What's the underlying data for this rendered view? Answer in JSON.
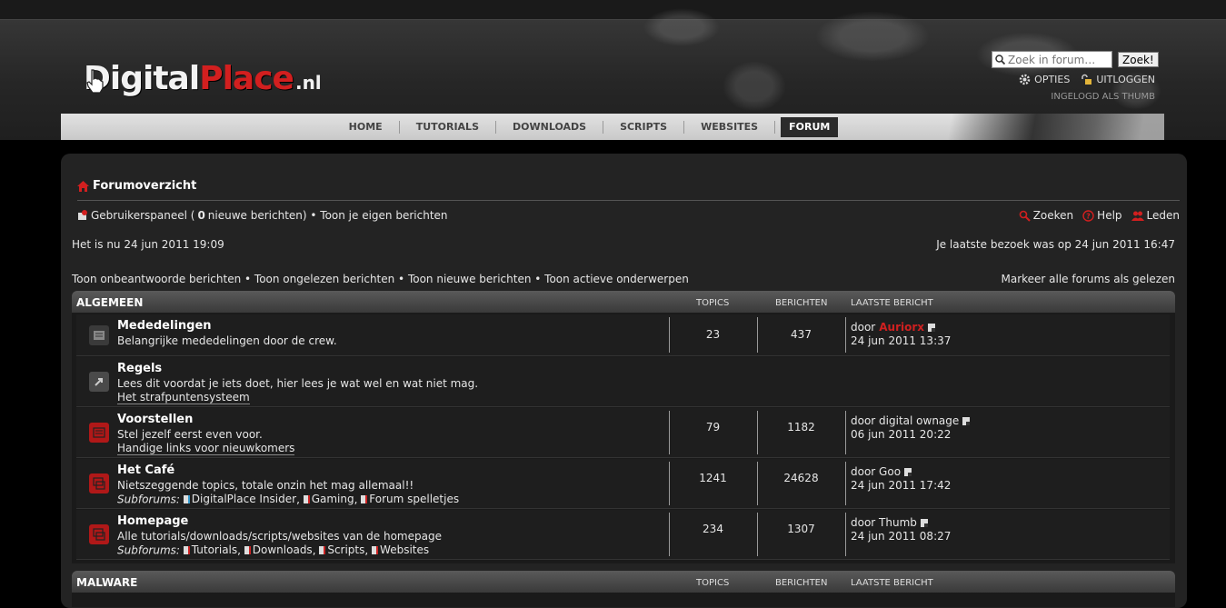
{
  "header": {
    "logo": {
      "part1": "Digital",
      "part2": "Place",
      "part3": ".nl"
    },
    "search": {
      "placeholder": "Zoek in forum…",
      "button": "Zoek!"
    },
    "user_menu": {
      "options": "OPTIES",
      "logout": "UITLOGGEN",
      "logged_in": "INGELOGD ALS THUMB"
    },
    "nav": [
      "HOME",
      "TUTORIALS",
      "DOWNLOADS",
      "SCRIPTS",
      "WEBSITES",
      "FORUM"
    ],
    "nav_active": "FORUM"
  },
  "breadcrumb": "Forumoverzicht",
  "panel": {
    "ucp_prefix": "Gebruikerspaneel (",
    "new_count": "0",
    "ucp_suffix": " nieuwe berichten) • Toon je eigen berichten",
    "search": "Zoeken",
    "help": "Help",
    "members": "Leden"
  },
  "time": {
    "now": "Het is nu 24 jun 2011 19:09",
    "last_visit": "Je laatste bezoek was op 24 jun 2011 16:47"
  },
  "links": {
    "left": "Toon onbeantwoorde berichten • Toon ongelezen berichten • Toon nieuwe berichten • Toon actieve onderwerpen",
    "right": "Markeer alle forums als gelezen"
  },
  "columns": {
    "topics": "TOPICS",
    "posts": "BERICHTEN",
    "last": "LAATSTE BERICHT"
  },
  "categories": [
    {
      "name": "ALGEMEEN",
      "forums": [
        {
          "name": "Mededelingen",
          "desc": "Belangrijke mededelingen door de crew.",
          "topics": "23",
          "posts": "437",
          "last_by_prefix": "door ",
          "last_by": "Auriorx",
          "last_date": "24 jun 2011 13:37"
        },
        {
          "name": "Regels",
          "desc": "Lees dit voordat je iets doet, hier lees je wat wel en wat niet mag.",
          "extra": "Het strafpuntensysteem"
        },
        {
          "name": "Voorstellen",
          "desc": "Stel jezelf eerst even voor.",
          "extra": "Handige links voor nieuwkomers",
          "topics": "79",
          "posts": "1182",
          "last_by": "door digital ownage",
          "last_date": "06 jun 2011 20:22"
        },
        {
          "name": "Het Café",
          "desc": "Nietszeggende topics, totale onzin het mag allemaal!!",
          "subforums_label": "Subforums:",
          "subforums": [
            "DigitalPlace Insider",
            "Gaming",
            "Forum spelletjes"
          ],
          "topics": "1241",
          "posts": "24628",
          "last_by": "door Goo",
          "last_date": "24 jun 2011 17:42"
        },
        {
          "name": "Homepage",
          "desc": "Alle tutorials/downloads/scripts/websites van de homepage",
          "subforums_label": "Subforums:",
          "subforums": [
            "Tutorials",
            "Downloads",
            "Scripts",
            "Websites"
          ],
          "topics": "234",
          "posts": "1307",
          "last_by": "door Thumb",
          "last_date": "24 jun 2011 08:27"
        }
      ]
    },
    {
      "name": "MALWARE",
      "forums": []
    }
  ],
  "colors": {
    "accent": "#d21f1f",
    "background": "#000000",
    "panel": "#232323"
  }
}
